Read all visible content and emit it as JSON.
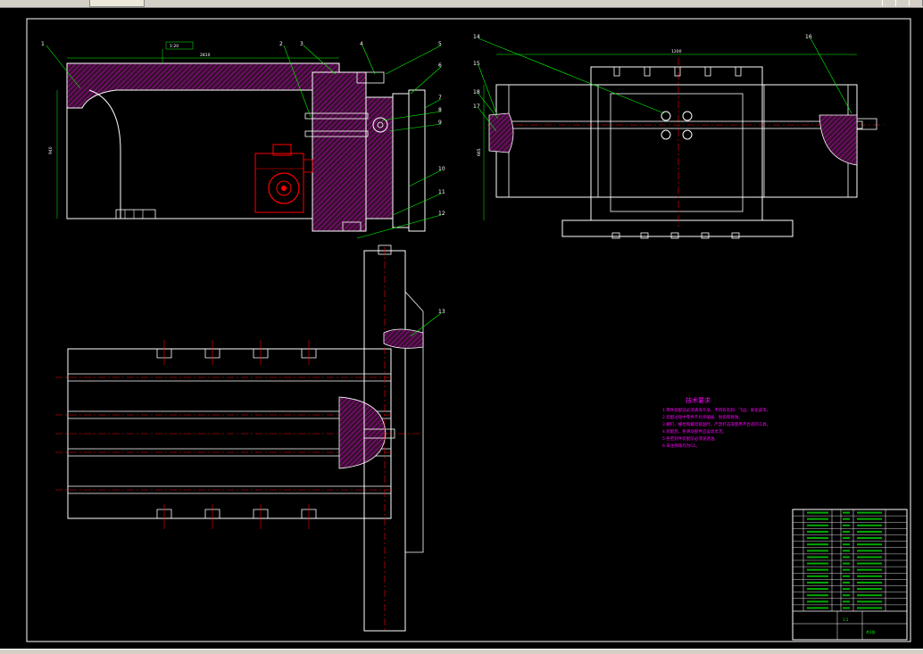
{
  "notes": {
    "title": "技术要求",
    "lines": [
      "1.零件装配前必须清洗干净，不得有毛刺、飞边、氧化皮等。",
      "2.装配过程中零件不允许磕碰、划伤和锈蚀。",
      "3.螺钉、螺栓和螺母紧固时，严禁打击或使用不合适的工具。",
      "4.装配后，各滑动部件应运动灵活。",
      "5.各密封件装配前必须浸透油。",
      "6.未注倒角均为C1。"
    ]
  },
  "balloons": [
    "1",
    "2",
    "3",
    "4",
    "5",
    "6",
    "7",
    "8",
    "9",
    "10",
    "11",
    "12",
    "13",
    "14",
    "15",
    "16",
    "17",
    "18"
  ],
  "dimensions": {
    "top_top": "1:20",
    "top_width": "2810",
    "side_height": "940",
    "right_width": "1200",
    "right_height": "665"
  },
  "title_block": {
    "scale": "1:1",
    "sheet": "共1张"
  },
  "colors": {
    "background": "#000000",
    "outline": "#ffffff",
    "centerline": "#ff0000",
    "hatch": "#ff00ff",
    "leader": "#00ff00",
    "motor": "#ff0000",
    "frame": "#ffffff",
    "titleblock": "#ffffff"
  }
}
